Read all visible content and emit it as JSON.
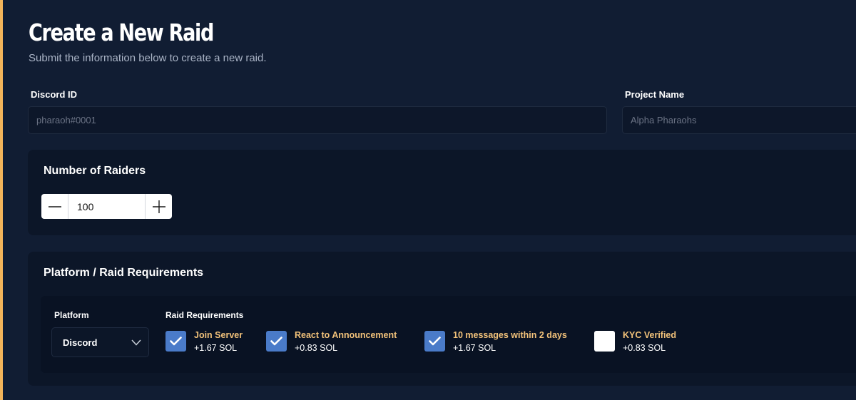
{
  "header": {
    "title": "Create a New Raid",
    "subtitle": "Submit the information below to create a new raid."
  },
  "form": {
    "discord_id": {
      "label": "Discord ID",
      "value": "",
      "placeholder": "pharaoh#0001"
    },
    "project_name": {
      "label": "Project Name",
      "value": "",
      "placeholder": "Alpha Pharaohs"
    }
  },
  "raiders": {
    "title": "Number of Raiders",
    "value": "100"
  },
  "requirements": {
    "title": "Platform / Raid Requirements",
    "platform_label": "Platform",
    "platform_selected": "Discord",
    "requirements_label": "Raid Requirements",
    "items": [
      {
        "name": "Join Server",
        "price": "+1.67 SOL",
        "checked": true
      },
      {
        "name": "React to Announcement",
        "price": "+0.83 SOL",
        "checked": true
      },
      {
        "name": "10 messages within 2 days",
        "price": "+1.67 SOL",
        "checked": true
      },
      {
        "name": "KYC Verified",
        "price": "+0.83 SOL",
        "checked": false
      }
    ]
  },
  "colors": {
    "background": "#111d33",
    "card": "#0c1628",
    "accent_stripe": "#f2b45a",
    "requirement_name": "#f2c27a",
    "checkbox_checked": "#4a7bc9"
  },
  "icons": {
    "decrement": "minus-icon",
    "increment": "plus-icon",
    "dropdown": "chevron-down-icon",
    "check": "checkmark-icon"
  }
}
